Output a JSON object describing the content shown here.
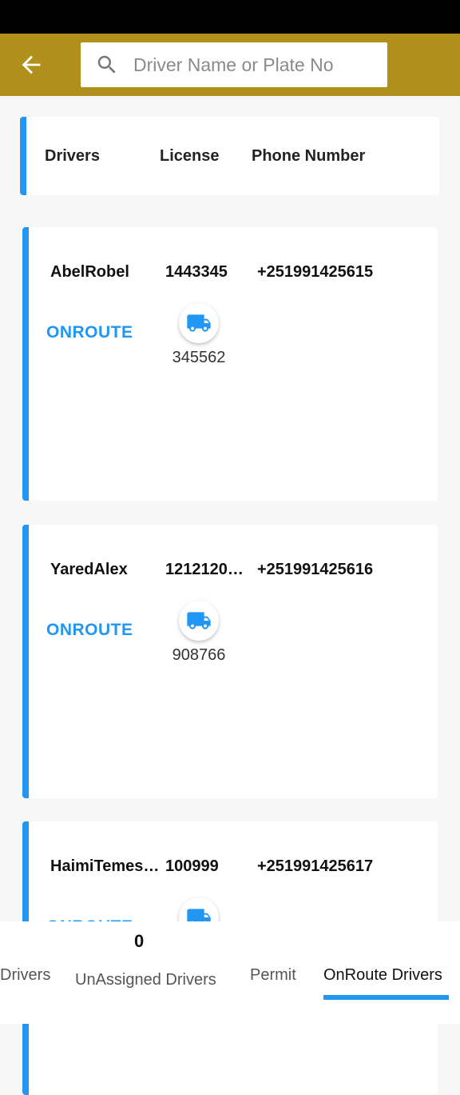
{
  "search": {
    "placeholder": "Driver Name or Plate No"
  },
  "header": {
    "col_drivers": "Drivers",
    "col_license": "License",
    "col_phone": "Phone Number"
  },
  "drivers": [
    {
      "name": "AbelRobel",
      "license": "1443345",
      "phone": "+251991425615",
      "status": "ONROUTE",
      "plate": "345562"
    },
    {
      "name": "YaredAlex",
      "license": "1212120…",
      "phone": "+251991425616",
      "status": "ONROUTE",
      "plate": "908766"
    },
    {
      "name": "HaimiTemes…",
      "license": "100999",
      "phone": "+251991425617",
      "status": "ONROUTE",
      "plate": ""
    }
  ],
  "tabs": {
    "drivers": "Drivers",
    "unassigned": "UnAssigned Drivers",
    "unassigned_count": "0",
    "permit": "Permit",
    "onroute": "OnRoute Drivers"
  },
  "colors": {
    "appbar": "#b08f1a",
    "accent": "#2196f3"
  }
}
